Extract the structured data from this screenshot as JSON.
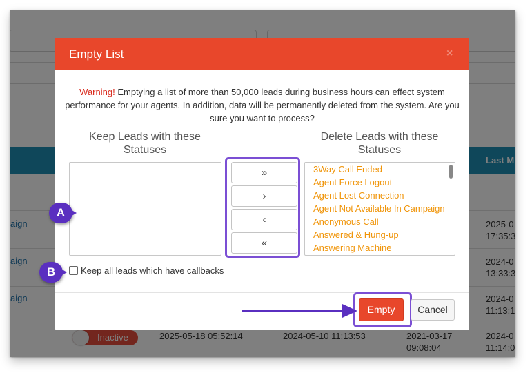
{
  "background": {
    "header_last_col": "Last M",
    "rows": [
      {
        "campaign": "aign",
        "last": "2025-0",
        "last2": "17:35:3"
      },
      {
        "campaign": "aign",
        "last": "2024-0",
        "last2": "13:33:3"
      },
      {
        "campaign": "aign",
        "last": "2024-0",
        "last2": "11:13:1"
      },
      {
        "toggle": "Inactive",
        "col1": "2025-05-18 05:52:14",
        "col2": "2024-05-10 11:13:53",
        "col3a": "2021-03-17",
        "col3b": "09:08:04",
        "last": "2024-0",
        "last2": "11:14:0"
      }
    ]
  },
  "modal": {
    "title": "Empty List",
    "close_icon": "×",
    "warning_prefix": "Warning!",
    "warning_text": " Emptying a list of more than 50,000 leads during business hours can effect system performance for your agents. In addition, data will be permanently deleted from the system. Are you sure you want to process?",
    "keep_heading": "Keep Leads with these Statuses",
    "delete_heading": "Delete Leads with these Statuses",
    "move_buttons": {
      "move_all_right": "»",
      "move_right": "›",
      "move_left": "‹",
      "move_all_left": "«"
    },
    "delete_statuses": [
      "3Way Call Ended",
      "Agent Force Logout",
      "Agent Lost Connection",
      "Agent Not Available In Campaign",
      "Anonymous Call",
      "Answered & Hung-up",
      "Answering Machine"
    ],
    "checkbox_label": "Keep all leads which have callbacks",
    "empty_button": "Empty",
    "cancel_button": "Cancel"
  },
  "annotations": {
    "a": "A",
    "b": "B"
  },
  "colors": {
    "header": "#e8472b",
    "highlight": "#7b4fd4",
    "status_text": "#f0950a",
    "badge": "#5a2fc0"
  }
}
